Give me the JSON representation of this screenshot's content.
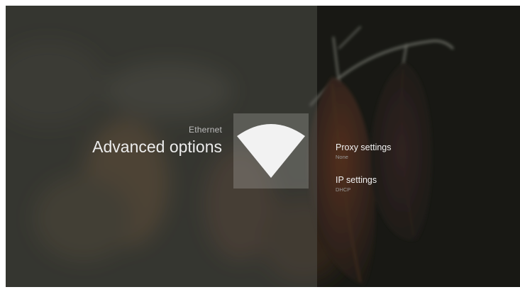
{
  "guidance": {
    "breadcrumb": "Ethernet",
    "title": "Advanced options",
    "icon": "wifi-icon"
  },
  "actions": [
    {
      "title": "Proxy settings",
      "description": "None"
    },
    {
      "title": "IP settings",
      "description": "DHCP"
    }
  ],
  "colors": {
    "left_panel": "#4a4a44",
    "right_panel": "#1a1c18",
    "leaf_dark": "#3a2a22",
    "leaf_accent": "#7a4a2a",
    "icon": "#f2f2f2"
  }
}
